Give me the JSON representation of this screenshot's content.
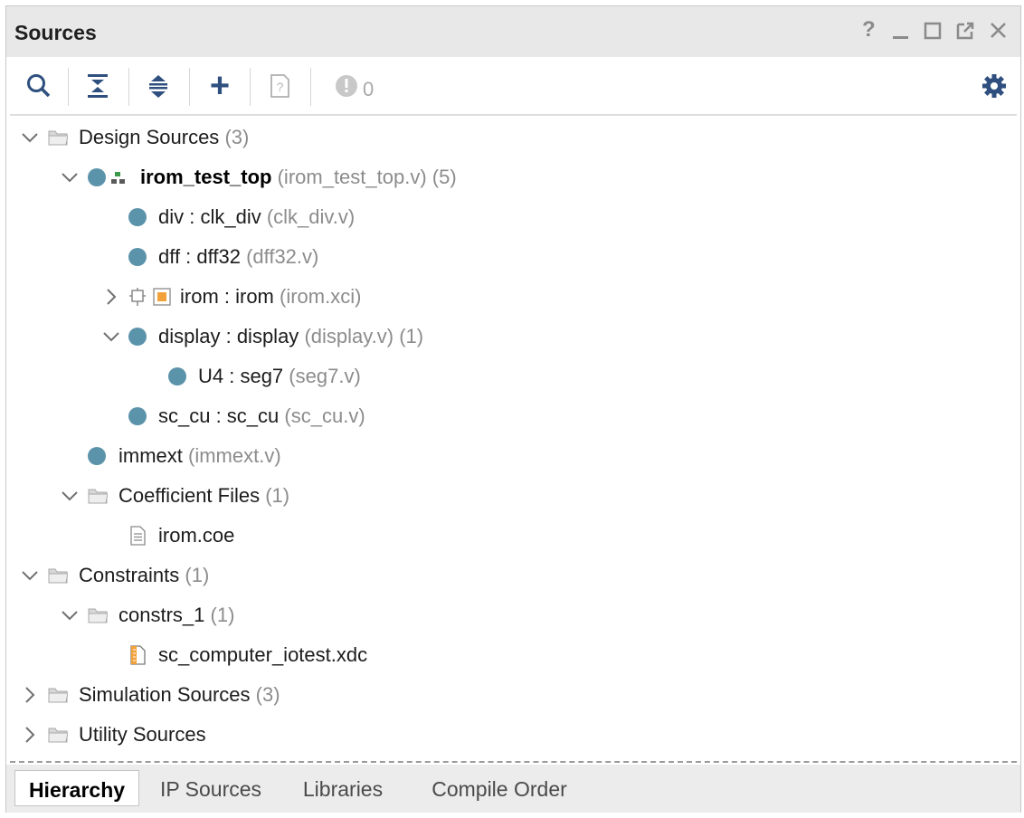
{
  "panel": {
    "title": "Sources",
    "window_controls": [
      "help-icon",
      "minimize-icon",
      "maximize-icon",
      "float-icon",
      "close-icon"
    ],
    "window_controls_text": {
      "help": "?",
      "close": "✕"
    }
  },
  "toolbar": {
    "buttons": [
      "search-icon",
      "collapse-all-icon",
      "expand-all-icon",
      "add-sources-icon",
      "documentation-icon",
      "status-icon",
      "settings-icon"
    ],
    "status_count": "0",
    "add_symbol": "+"
  },
  "tree": {
    "design_sources": {
      "label": "Design Sources",
      "count": "(3)"
    },
    "top": {
      "name": "irom_test_top",
      "file": "(irom_test_top.v)",
      "count": "(5)"
    },
    "div": {
      "name": "div : clk_div",
      "file": "(clk_div.v)"
    },
    "dff": {
      "name": "dff : dff32",
      "file": "(dff32.v)"
    },
    "irom": {
      "name": "irom : irom",
      "file": "(irom.xci)"
    },
    "display": {
      "name": "display : display",
      "file": "(display.v)",
      "count": "(1)"
    },
    "u4": {
      "name": "U4 : seg7",
      "file": "(seg7.v)"
    },
    "sc_cu": {
      "name": "sc_cu : sc_cu",
      "file": "(sc_cu.v)"
    },
    "immext": {
      "name": "immext",
      "file": "(immext.v)"
    },
    "coeff": {
      "label": "Coefficient Files",
      "count": "(1)"
    },
    "coe_file": {
      "name": "irom.coe"
    },
    "constraints": {
      "label": "Constraints",
      "count": "(1)"
    },
    "constrs_1": {
      "label": "constrs_1",
      "count": "(1)"
    },
    "xdc_file": {
      "name": "sc_computer_iotest.xdc"
    },
    "simulation": {
      "label": "Simulation Sources",
      "count": "(3)"
    },
    "utility": {
      "label": "Utility Sources"
    }
  },
  "tabs": [
    "Hierarchy",
    "IP Sources",
    "Libraries",
    "Compile Order"
  ],
  "colors": {
    "accent": "#2f4f7f",
    "node_dot": "#5b93aa",
    "muted_text": "#8c8c8c",
    "ip_orange": "#f3a23b",
    "hier_green": "#3a9a4a"
  }
}
